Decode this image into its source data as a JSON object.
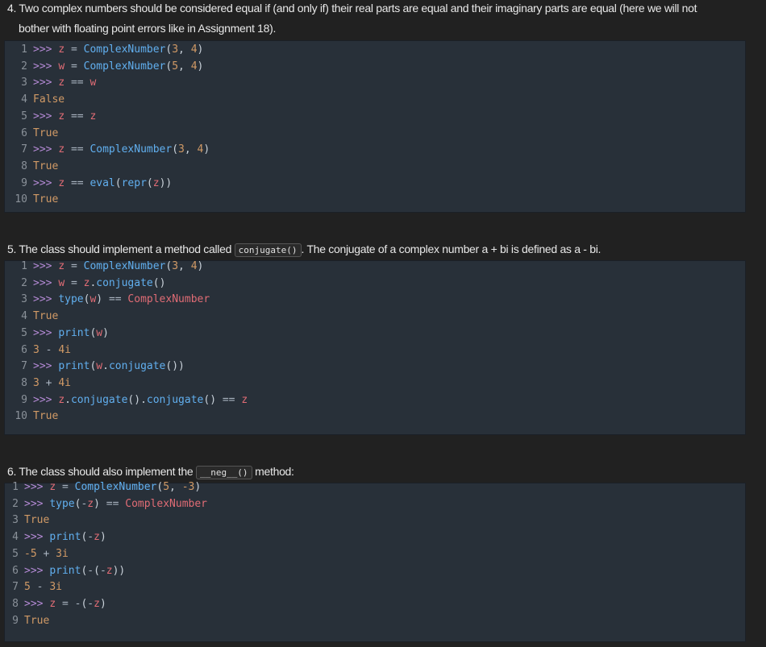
{
  "section4": {
    "text_line1": "4. Two complex numbers should be considered equal if (and only if) their real parts are equal and their imaginary parts are equal (here we will not",
    "text_line2": "bother with floating point errors like in Assignment 18).",
    "code": [
      ">>> z = ComplexNumber(3, 4)",
      ">>> w = ComplexNumber(5, 4)",
      ">>> z == w",
      "False",
      ">>> z == z",
      "True",
      ">>> z == ComplexNumber(3, 4)",
      "True",
      ">>> z == eval(repr(z))",
      "True"
    ]
  },
  "section5": {
    "text_before": "5. The class should implement a method called ",
    "inline_code": "conjugate()",
    "text_after": ". The conjugate of a complex number a + bi is defined as a - bi.",
    "code": [
      ">>> z = ComplexNumber(3, 4)",
      ">>> w = z.conjugate()",
      ">>> type(w) == ComplexNumber",
      "True",
      ">>> print(w)",
      "3 - 4i",
      ">>> print(w.conjugate())",
      "3 + 4i",
      ">>> z.conjugate().conjugate() == z",
      "True"
    ]
  },
  "section6": {
    "text_before": "6. The class should also implement the ",
    "inline_code": "__neg__()",
    "text_after": " method:",
    "code": [
      ">>> z = ComplexNumber(5, -3)",
      ">>> type(-z) == ComplexNumber",
      "True",
      ">>> print(-z)",
      "-5 + 3i",
      ">>> print(-(-z))",
      "5 - 3i",
      ">>> z = -(-z)",
      "True"
    ]
  },
  "colors": {
    "page_bg": "#212121",
    "code_bg": "#283039",
    "prompt": "#b58ad6",
    "variable": "#e06c75",
    "class_name": "#61afef",
    "number": "#d19a66",
    "line_number": "#8a9199"
  }
}
